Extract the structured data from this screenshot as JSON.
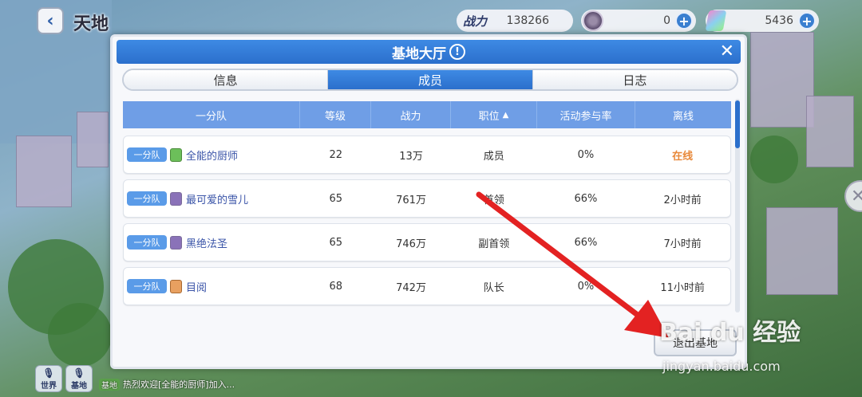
{
  "header": {
    "world_title": "天地",
    "power": {
      "label": "战力",
      "value": "138266"
    },
    "gems": {
      "value": "0"
    },
    "crystals": {
      "value": "5436"
    }
  },
  "dialog": {
    "title": "基地大厅",
    "tabs": [
      {
        "label": "信息",
        "active": false
      },
      {
        "label": "成员",
        "active": true
      },
      {
        "label": "日志",
        "active": false
      }
    ],
    "columns": [
      "一分队",
      "等级",
      "战力",
      "职位",
      "活动参与率",
      "离线"
    ],
    "rows": [
      {
        "squad": "一分队",
        "name": "全能的厨师",
        "level": "22",
        "power": "13万",
        "position": "成员",
        "rate": "0%",
        "offline": "在线"
      },
      {
        "squad": "一分队",
        "name": "最可爱的雪儿",
        "level": "65",
        "power": "761万",
        "position": "首领",
        "rate": "66%",
        "offline": "2小时前"
      },
      {
        "squad": "一分队",
        "name": "黑绝法圣",
        "level": "65",
        "power": "746万",
        "position": "副首领",
        "rate": "66%",
        "offline": "7小时前"
      },
      {
        "squad": "一分队",
        "name": "目阅",
        "level": "68",
        "power": "742万",
        "position": "队长",
        "rate": "0%",
        "offline": "11小时前"
      }
    ],
    "leave_button": "退出基地"
  },
  "chat": {
    "world_btn": "世界",
    "base_btn": "基地",
    "messages": [
      {
        "tag": "基地",
        "text": "热烈欢迎[全能的厨师]加入..."
      }
    ]
  },
  "watermark": {
    "brand": "Bai du 经验",
    "url": "jingyan.baidu.com"
  },
  "colors": {
    "accent": "#2b6fcc",
    "online": "#e8883a",
    "arrow": "#e32222"
  }
}
